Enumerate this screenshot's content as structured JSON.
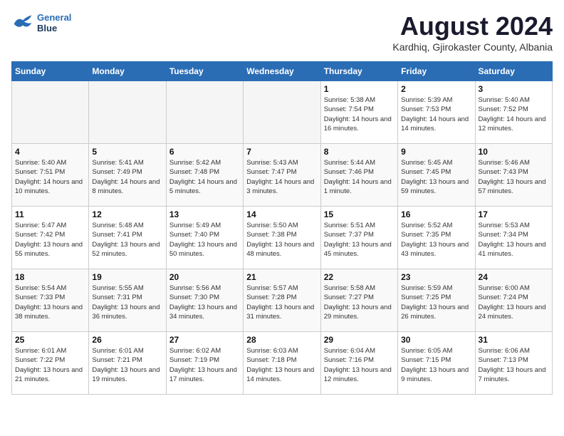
{
  "header": {
    "logo_line1": "General",
    "logo_line2": "Blue",
    "month": "August 2024",
    "location": "Kardhiq, Gjirokaster County, Albania"
  },
  "weekdays": [
    "Sunday",
    "Monday",
    "Tuesday",
    "Wednesday",
    "Thursday",
    "Friday",
    "Saturday"
  ],
  "weeks": [
    [
      {
        "day": "",
        "info": ""
      },
      {
        "day": "",
        "info": ""
      },
      {
        "day": "",
        "info": ""
      },
      {
        "day": "",
        "info": ""
      },
      {
        "day": "1",
        "info": "Sunrise: 5:38 AM\nSunset: 7:54 PM\nDaylight: 14 hours and 16 minutes."
      },
      {
        "day": "2",
        "info": "Sunrise: 5:39 AM\nSunset: 7:53 PM\nDaylight: 14 hours and 14 minutes."
      },
      {
        "day": "3",
        "info": "Sunrise: 5:40 AM\nSunset: 7:52 PM\nDaylight: 14 hours and 12 minutes."
      }
    ],
    [
      {
        "day": "4",
        "info": "Sunrise: 5:40 AM\nSunset: 7:51 PM\nDaylight: 14 hours and 10 minutes."
      },
      {
        "day": "5",
        "info": "Sunrise: 5:41 AM\nSunset: 7:49 PM\nDaylight: 14 hours and 8 minutes."
      },
      {
        "day": "6",
        "info": "Sunrise: 5:42 AM\nSunset: 7:48 PM\nDaylight: 14 hours and 5 minutes."
      },
      {
        "day": "7",
        "info": "Sunrise: 5:43 AM\nSunset: 7:47 PM\nDaylight: 14 hours and 3 minutes."
      },
      {
        "day": "8",
        "info": "Sunrise: 5:44 AM\nSunset: 7:46 PM\nDaylight: 14 hours and 1 minute."
      },
      {
        "day": "9",
        "info": "Sunrise: 5:45 AM\nSunset: 7:45 PM\nDaylight: 13 hours and 59 minutes."
      },
      {
        "day": "10",
        "info": "Sunrise: 5:46 AM\nSunset: 7:43 PM\nDaylight: 13 hours and 57 minutes."
      }
    ],
    [
      {
        "day": "11",
        "info": "Sunrise: 5:47 AM\nSunset: 7:42 PM\nDaylight: 13 hours and 55 minutes."
      },
      {
        "day": "12",
        "info": "Sunrise: 5:48 AM\nSunset: 7:41 PM\nDaylight: 13 hours and 52 minutes."
      },
      {
        "day": "13",
        "info": "Sunrise: 5:49 AM\nSunset: 7:40 PM\nDaylight: 13 hours and 50 minutes."
      },
      {
        "day": "14",
        "info": "Sunrise: 5:50 AM\nSunset: 7:38 PM\nDaylight: 13 hours and 48 minutes."
      },
      {
        "day": "15",
        "info": "Sunrise: 5:51 AM\nSunset: 7:37 PM\nDaylight: 13 hours and 45 minutes."
      },
      {
        "day": "16",
        "info": "Sunrise: 5:52 AM\nSunset: 7:35 PM\nDaylight: 13 hours and 43 minutes."
      },
      {
        "day": "17",
        "info": "Sunrise: 5:53 AM\nSunset: 7:34 PM\nDaylight: 13 hours and 41 minutes."
      }
    ],
    [
      {
        "day": "18",
        "info": "Sunrise: 5:54 AM\nSunset: 7:33 PM\nDaylight: 13 hours and 38 minutes."
      },
      {
        "day": "19",
        "info": "Sunrise: 5:55 AM\nSunset: 7:31 PM\nDaylight: 13 hours and 36 minutes."
      },
      {
        "day": "20",
        "info": "Sunrise: 5:56 AM\nSunset: 7:30 PM\nDaylight: 13 hours and 34 minutes."
      },
      {
        "day": "21",
        "info": "Sunrise: 5:57 AM\nSunset: 7:28 PM\nDaylight: 13 hours and 31 minutes."
      },
      {
        "day": "22",
        "info": "Sunrise: 5:58 AM\nSunset: 7:27 PM\nDaylight: 13 hours and 29 minutes."
      },
      {
        "day": "23",
        "info": "Sunrise: 5:59 AM\nSunset: 7:25 PM\nDaylight: 13 hours and 26 minutes."
      },
      {
        "day": "24",
        "info": "Sunrise: 6:00 AM\nSunset: 7:24 PM\nDaylight: 13 hours and 24 minutes."
      }
    ],
    [
      {
        "day": "25",
        "info": "Sunrise: 6:01 AM\nSunset: 7:22 PM\nDaylight: 13 hours and 21 minutes."
      },
      {
        "day": "26",
        "info": "Sunrise: 6:01 AM\nSunset: 7:21 PM\nDaylight: 13 hours and 19 minutes."
      },
      {
        "day": "27",
        "info": "Sunrise: 6:02 AM\nSunset: 7:19 PM\nDaylight: 13 hours and 17 minutes."
      },
      {
        "day": "28",
        "info": "Sunrise: 6:03 AM\nSunset: 7:18 PM\nDaylight: 13 hours and 14 minutes."
      },
      {
        "day": "29",
        "info": "Sunrise: 6:04 AM\nSunset: 7:16 PM\nDaylight: 13 hours and 12 minutes."
      },
      {
        "day": "30",
        "info": "Sunrise: 6:05 AM\nSunset: 7:15 PM\nDaylight: 13 hours and 9 minutes."
      },
      {
        "day": "31",
        "info": "Sunrise: 6:06 AM\nSunset: 7:13 PM\nDaylight: 13 hours and 7 minutes."
      }
    ]
  ]
}
